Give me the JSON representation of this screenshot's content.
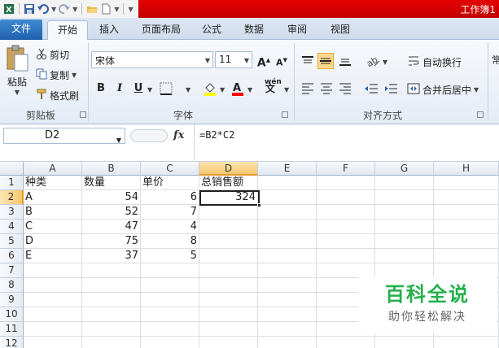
{
  "window": {
    "title": "工作簿1"
  },
  "tabs": {
    "file": "文件",
    "items": [
      "开始",
      "插入",
      "页面布局",
      "公式",
      "数据",
      "审阅",
      "视图"
    ]
  },
  "ribbon": {
    "clipboard": {
      "paste": "粘贴",
      "cut": "剪切",
      "copy": "复制",
      "format_painter": "格式刷",
      "label": "剪贴板"
    },
    "font": {
      "name": "宋体",
      "size": "11",
      "bold": "B",
      "italic": "I",
      "underline": "U",
      "label": "字体",
      "grow": "A",
      "shrink": "A",
      "wen": "wén"
    },
    "alignment": {
      "wrap": "自动换行",
      "merge": "合并后居中",
      "label": "对齐方式"
    },
    "number": {
      "cut_char": "常"
    }
  },
  "formula_bar": {
    "name_box": "D2",
    "fx": "fx",
    "formula": "=B2*C2"
  },
  "sheet": {
    "columns": [
      "A",
      "B",
      "C",
      "D",
      "E",
      "F",
      "G",
      "H"
    ],
    "rows": [
      "1",
      "2",
      "3",
      "4",
      "5",
      "6",
      "7",
      "8",
      "9",
      "10",
      "11",
      "12"
    ],
    "header": [
      "种类",
      "数量",
      "单价",
      "总销售额"
    ],
    "data": [
      [
        "A",
        "54",
        "6",
        "324"
      ],
      [
        "B",
        "52",
        "7",
        ""
      ],
      [
        "C",
        "47",
        "4",
        ""
      ],
      [
        "D",
        "75",
        "8",
        ""
      ],
      [
        "E",
        "37",
        "5",
        ""
      ]
    ]
  },
  "watermark": {
    "title": "百科全说",
    "subtitle": "助你轻松解决"
  },
  "colors": {
    "accent_red": "#d40000",
    "file_tab": "#2f74c3",
    "selection": "#f5c870",
    "watermark_green": "#24b04b"
  }
}
